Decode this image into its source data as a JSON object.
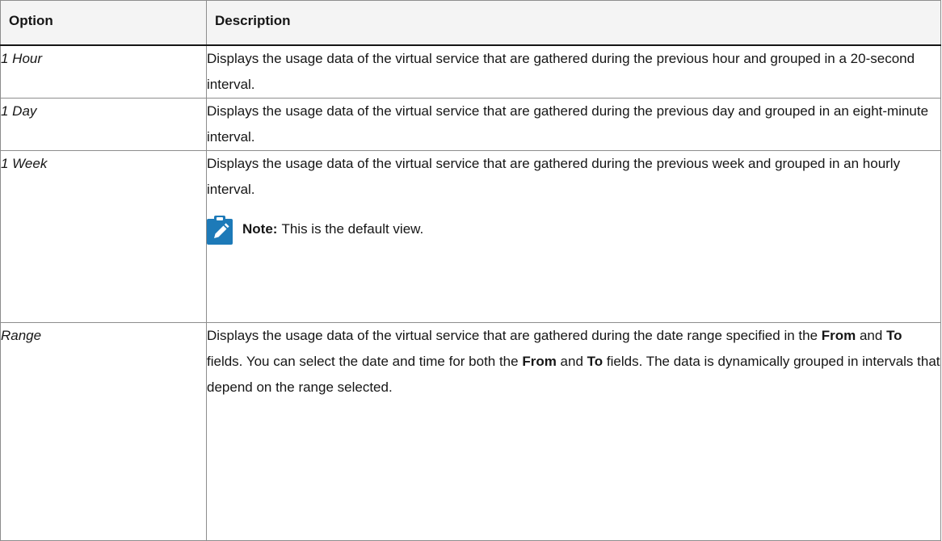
{
  "table": {
    "headers": {
      "option": "Option",
      "description": "Description"
    },
    "rows": [
      {
        "option": "1 Hour",
        "description": "Displays the usage data of the virtual service that are gathered during the previous hour and grouped in a 20-second interval."
      },
      {
        "option": "1 Day",
        "description": "Displays the usage data of the virtual service that are gathered during the previous day and grouped in an eight-minute interval."
      },
      {
        "option": "1 Week",
        "description": "Displays the usage data of the virtual service that are gathered during the previous week and grouped in an hourly interval.",
        "note": {
          "label": "Note:",
          "text": "This is the default view.",
          "icon": "note-pencil-icon"
        }
      },
      {
        "option": "Range",
        "description_parts": {
          "p1": "Displays the usage data of the virtual service that are gathered during the date range specified in the ",
          "from1": "From",
          "p2": " and ",
          "to1": "To",
          "p3": " fields. You can select the date and time for both the ",
          "from2": "From",
          "p4": " and ",
          "to2": "To",
          "p5": " fields. The data is dynamically grouped in intervals that depend on the range selected."
        }
      }
    ]
  },
  "colors": {
    "icon_background": "#1d7ab8",
    "border": "#8d8d8d",
    "header_background": "#f4f4f4"
  }
}
